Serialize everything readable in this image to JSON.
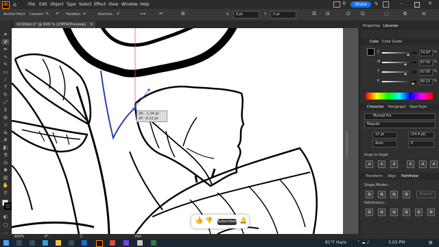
{
  "menubar": {
    "menus": [
      "File",
      "Edit",
      "Object",
      "Type",
      "Select",
      "Effect",
      "View",
      "Window",
      "Help"
    ],
    "share_label": "Share"
  },
  "control_bar": {
    "anchor_point": "Anchor Point",
    "convert": "Convert:",
    "handles": "Handles:",
    "anchors": "Anchors:",
    "stroke1": "0 pt",
    "stroke2": "0 pt"
  },
  "document": {
    "tab_label": "Untitled-1* @ 600 % (CMYK/Preview)",
    "zoom": "600%",
    "rotation": "0°",
    "page": "1",
    "mode": "Pen"
  },
  "tooltip": {
    "dx": "dX: -1.24 pt",
    "dy": "dY: -0.52 pt"
  },
  "youtube": {
    "subscribed_label": "Subscribed"
  },
  "panels": {
    "tabs": [
      "Properties",
      "Libraries"
    ],
    "color": {
      "tabs": [
        "Color",
        "Color Guide"
      ],
      "channels": [
        {
          "label": "C",
          "value": "74.97",
          "pos": 0.75
        },
        {
          "label": "M",
          "value": "67.92",
          "pos": 0.68
        },
        {
          "label": "Y",
          "value": "67.05",
          "pos": 0.67
        },
        {
          "label": "K",
          "value": "90.15",
          "pos": 0.9
        }
      ],
      "percent": "%"
    },
    "character": {
      "tabs": [
        "Character",
        "Paragraph",
        "OpenType"
      ],
      "font": "Myriad Pro",
      "style": "Regular",
      "size": "12 pt",
      "leading": "(14.4 pt)",
      "kerning": "Auto",
      "tracking": "0"
    },
    "snap_label": "Snap to Glyph",
    "transform": {
      "tabs": [
        "Transform",
        "Align",
        "Pathfinder"
      ],
      "shape_modes": "Shape Modes:",
      "pathfinders": "Pathfinders:",
      "expand": "Expand"
    }
  },
  "taskbar": {
    "weather": "81°F Haze",
    "time": "3:03 PM"
  },
  "colors": {
    "accent": "#1473e6",
    "canvas": "#ffffff",
    "ui": "#323232"
  }
}
